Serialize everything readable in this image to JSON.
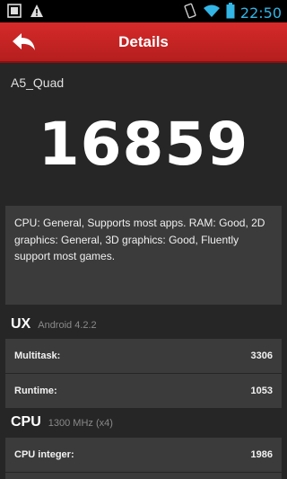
{
  "status_bar": {
    "time": "22:50",
    "icons": [
      "notification-icon",
      "warning-icon",
      "vibrate-icon",
      "wifi-icon",
      "battery-icon"
    ]
  },
  "action_bar": {
    "title": "Details",
    "back_icon": "back-arrow-icon"
  },
  "device_name": "A5_Quad",
  "score": "16859",
  "summary": "CPU: General, Supports most apps. RAM: Good, 2D graphics: General, 3D graphics: Good, Fluently support most games.",
  "sections": {
    "ux": {
      "title": "UX",
      "subtitle": "Android 4.2.2",
      "rows": [
        {
          "label": "Multitask:",
          "value": "3306"
        },
        {
          "label": "Runtime:",
          "value": "1053"
        }
      ]
    },
    "cpu": {
      "title": "CPU",
      "subtitle": "1300 MHz (x4)",
      "rows": [
        {
          "label": "CPU integer:",
          "value": "1986"
        }
      ]
    }
  },
  "colors": {
    "accent": "#c62424",
    "background": "#262626",
    "card": "#3b3b3b",
    "clock": "#33b5e5"
  }
}
